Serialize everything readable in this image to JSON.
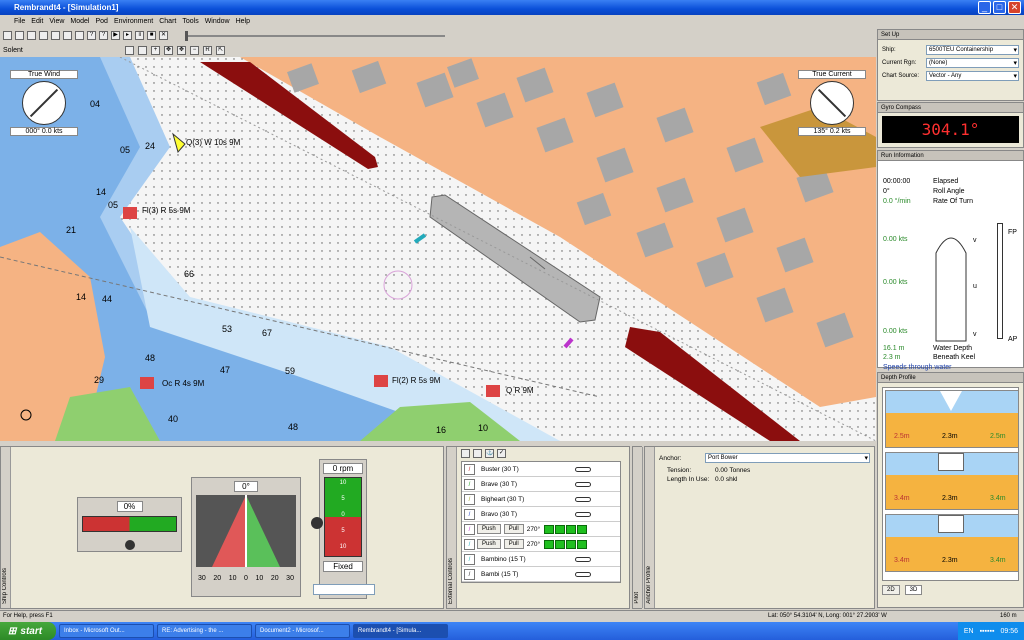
{
  "window": {
    "title": "Rembrandt4 - [Simulation1]",
    "controls": [
      "_",
      "□",
      "✕"
    ]
  },
  "menu": [
    "File",
    "Edit",
    "View",
    "Model",
    "Pod",
    "Environment",
    "Chart",
    "Tools",
    "Window",
    "Help"
  ],
  "chart_tab": "Solent",
  "wind": {
    "title": "True Wind",
    "readout": "000° 0.0 kts"
  },
  "current": {
    "title": "True Current",
    "readout": "135° 0.2 kts"
  },
  "map_labels": {
    "l1": "Q(3) W 10s 9M",
    "l2": "Fl(3) R 5s 9M",
    "l3": "Oc R 4s 9M",
    "l4": "Fl(2) R 5s 9M",
    "l5": "Q R 9M"
  },
  "depths": [
    "04",
    "05",
    "24",
    "14",
    "05",
    "21",
    "66",
    "14",
    "44",
    "53",
    "67",
    "48",
    "47",
    "59",
    "29",
    "48",
    "40",
    "16",
    "10",
    "16",
    "5",
    "2",
    "1"
  ],
  "setup": {
    "title": "Set Up",
    "ship_label": "Ship:",
    "ship_value": "6500TEU Containership",
    "rgn_label": "Current Rgn:",
    "rgn_value": "(None)",
    "src_label": "Chart Source:",
    "src_value": "Vector - Any"
  },
  "gyro": {
    "title": "Gyro Compass",
    "value": "304.1°"
  },
  "run": {
    "title": "Run Information",
    "elapsed_val": "00:00:00",
    "elapsed_lbl": "Elapsed",
    "roll_val": "0°",
    "roll_lbl": "Roll Angle",
    "rot_val": "0.0 °/min",
    "rot_lbl": "Rate Of Turn",
    "kts1": "0.00 kts",
    "kts2": "0.00 kts",
    "kts3": "0.00 kts",
    "wd_val": "16.1 m",
    "wd_lbl": "Water Depth",
    "bk_val": "2.3 m",
    "bk_lbl": "Beneath Keel",
    "note": "Speeds through water",
    "fp": "FP",
    "ap": "AP",
    "v1": "v",
    "u": "u",
    "v2": "v"
  },
  "depth": {
    "title": "Depth Profile",
    "rows": [
      [
        "2.5m",
        "2.3m",
        "2.5m"
      ],
      [
        "3.4m",
        "2.3m",
        "3.4m"
      ],
      [
        "3.4m",
        "2.3m",
        "3.4m"
      ]
    ],
    "tabs": [
      "2D",
      "3D"
    ]
  },
  "controls": {
    "rudder_pct": "0%",
    "azimuth": "0°",
    "azi_scale": [
      "30",
      "20",
      "10",
      "0",
      "10",
      "20",
      "30"
    ],
    "rpm": "0 rpm",
    "fixed": "Fixed",
    "tel_scale": [
      "10",
      "5",
      "0",
      "5",
      "10"
    ],
    "side1": "Ship Controls",
    "side2": "External Controls",
    "side3": "Pilot",
    "side4": "Anchor Profile"
  },
  "tugs": [
    {
      "name": "Buster (30 T)",
      "color": "#c02020"
    },
    {
      "name": "Brave (30 T)",
      "color": "#20a020"
    },
    {
      "name": "Bigheart (30 T)",
      "color": "#a0a020"
    },
    {
      "name": "Bravo (30 T)",
      "color": "#2040c0"
    },
    {
      "name": "Bambino (15 T)",
      "color": "#20b0b0"
    },
    {
      "name": "Bambi (15 T)",
      "color": "#202020"
    }
  ],
  "tug_active": {
    "push": "Push",
    "pull": "Pull",
    "bearing": "270°"
  },
  "anchor": {
    "label": "Anchor:",
    "value": "Port Bower",
    "tension_lbl": "Tension:",
    "tension_val": "0.00 Tonnes",
    "length_lbl": "Length In Use:",
    "length_val": "0.0 shkl"
  },
  "status": {
    "left": "For Help, press F1",
    "right": "Lat: 050° 54.3104' N, Long: 001° 27.2903' W",
    "scale": "160 m"
  },
  "taskbar": {
    "start": "start",
    "tasks": [
      "Inbox - Microsoft Out...",
      "RE: Advertising - the ...",
      "Document2 - Microsof...",
      "Rembrandt4 - [Simula..."
    ],
    "lang": "EN",
    "clock": "09:56"
  }
}
